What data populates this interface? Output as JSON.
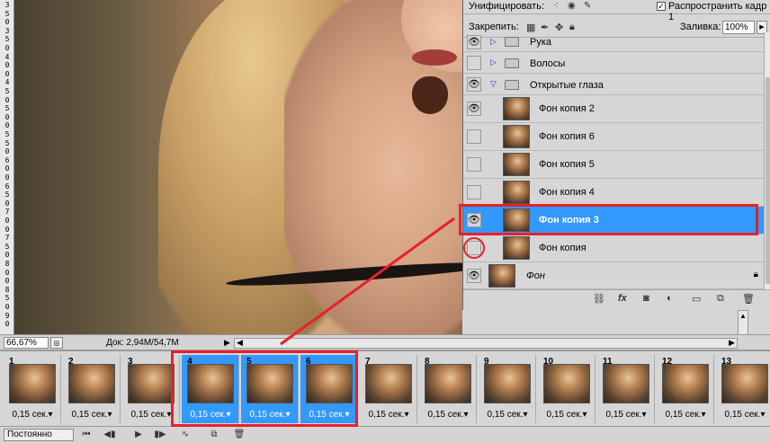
{
  "ruler": {
    "digits": [
      "3",
      "5",
      "0",
      "3",
      "5",
      "0",
      "4",
      "0",
      "0",
      "4",
      "5",
      "0",
      "5",
      "0",
      "0",
      "5",
      "5",
      "0",
      "6",
      "0",
      "0",
      "6",
      "5",
      "0",
      "7",
      "0",
      "0",
      "7",
      "5",
      "0",
      "8",
      "0",
      "0",
      "8",
      "5",
      "0",
      "9",
      "0"
    ]
  },
  "status": {
    "zoom": "66,67%",
    "doc_info": "Док: 2,94M/54,7M"
  },
  "layers_panel": {
    "unify_label": "Унифицировать:",
    "propagate_checked": true,
    "propagate_label": "Распространить кадр 1",
    "lock_label": "Закрепить:",
    "fill_label": "Заливка:",
    "fill_value": "100%",
    "layers": [
      {
        "name": "Рука",
        "type": "group",
        "visible": true,
        "expanded": false
      },
      {
        "name": "Волосы",
        "type": "group",
        "visible": false,
        "expanded": false
      },
      {
        "name": "Открытые глаза",
        "type": "group",
        "visible": true,
        "expanded": true
      },
      {
        "name": "Фон копия 2",
        "type": "layer",
        "visible": true
      },
      {
        "name": "Фон копия 6",
        "type": "layer",
        "visible": false
      },
      {
        "name": "Фон копия 5",
        "type": "layer",
        "visible": false
      },
      {
        "name": "Фон копия 4",
        "type": "layer",
        "visible": false
      },
      {
        "name": "Фон копия 3",
        "type": "layer",
        "visible": true,
        "selected": true
      },
      {
        "name": "Фон копия",
        "type": "layer",
        "visible": false
      },
      {
        "name": "Фон",
        "type": "background",
        "visible": true,
        "locked": true
      }
    ]
  },
  "timeline": {
    "frames": [
      {
        "num": "1",
        "duration": "0,15 сек.",
        "selected": false
      },
      {
        "num": "2",
        "duration": "0,15 сек.",
        "selected": false
      },
      {
        "num": "3",
        "duration": "0,15 сек.",
        "selected": false
      },
      {
        "num": "4",
        "duration": "0,15 сек.",
        "selected": true
      },
      {
        "num": "5",
        "duration": "0,15 сек.",
        "selected": true
      },
      {
        "num": "6",
        "duration": "0,15 сек.",
        "selected": true
      },
      {
        "num": "7",
        "duration": "0,15 сек.",
        "selected": false
      },
      {
        "num": "8",
        "duration": "0,15 сек.",
        "selected": false
      },
      {
        "num": "9",
        "duration": "0,15 сек.",
        "selected": false
      },
      {
        "num": "10",
        "duration": "0,15 сек.",
        "selected": false
      },
      {
        "num": "11",
        "duration": "0,15 сек.",
        "selected": false
      },
      {
        "num": "12",
        "duration": "0,15 сек.",
        "selected": false
      },
      {
        "num": "13",
        "duration": "0,15 сек.",
        "selected": false
      }
    ],
    "loop_option": "Постоянно"
  },
  "colors": {
    "selection": "#3399ff",
    "annotation": "#e8202a"
  }
}
